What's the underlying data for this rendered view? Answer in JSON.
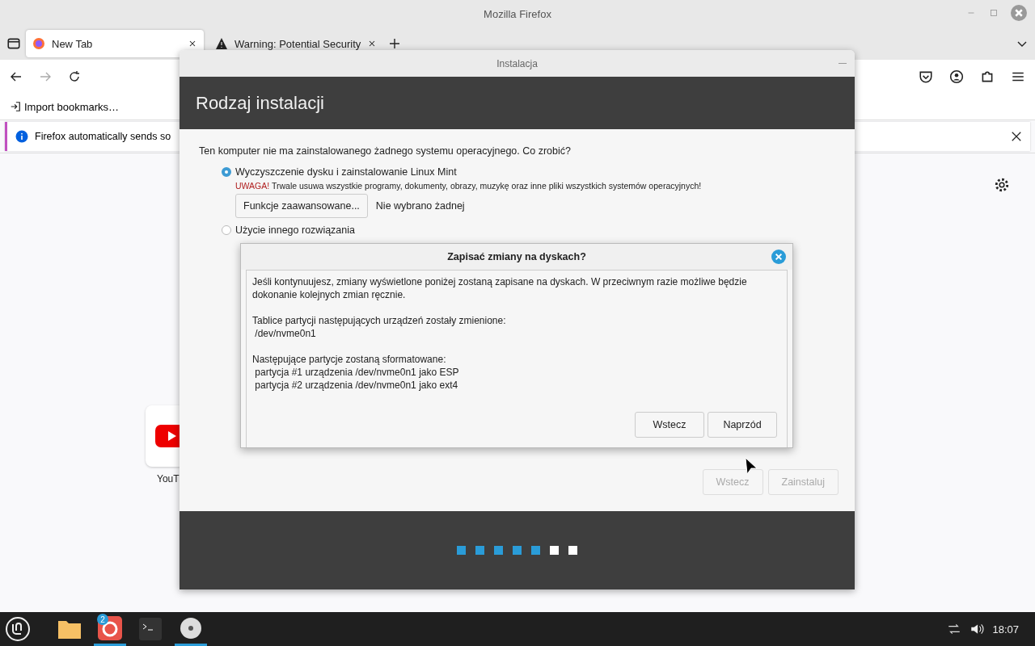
{
  "browser": {
    "title": "Mozilla Firefox",
    "tabs": [
      {
        "label": "New Tab",
        "selected": true
      },
      {
        "label": "Warning: Potential Security",
        "selected": false
      }
    ],
    "bookmarks": [
      "Import bookmarks…"
    ],
    "notification": "Firefox automatically sends so",
    "shortcuts": [
      {
        "label": "YouT"
      }
    ]
  },
  "installer": {
    "title": "Instalacja",
    "heading": "Rodzaj instalacji",
    "question": "Ten komputer nie ma zainstalowanego żadnego systemu operacyjnego. Co zrobić?",
    "options": [
      {
        "label": "Wyczyszczenie dysku i zainstalowanie Linux Mint",
        "selected": true,
        "warning_tag": "UWAGA!",
        "warning": "Trwale usuwa wszystkie programy, dokumenty, obrazy, muzykę oraz inne pliki wszystkich systemów operacyjnych!",
        "button": "Funkcje zaawansowane...",
        "note": "Nie wybrano żadnej"
      },
      {
        "label": "Użycie innego rozwiązania",
        "selected": false
      }
    ],
    "buttons": [
      {
        "label": "Wstecz",
        "disabled": true
      },
      {
        "label": "Zainstaluj",
        "disabled": true
      }
    ],
    "steps": [
      {
        "done": true
      },
      {
        "done": true
      },
      {
        "done": true
      },
      {
        "done": true
      },
      {
        "done": true
      },
      {
        "done": false
      },
      {
        "done": false
      }
    ]
  },
  "dialog": {
    "title": "Zapisać zmiany na dyskach?",
    "paragraphs": [
      [
        "Jeśli kontynuujesz, zmiany wyświetlone poniżej zostaną zapisane na dyskach. W przeciwnym razie możliwe będzie dokonanie kolejnych zmian ręcznie."
      ],
      [
        "Tablice partycji następujących urządzeń zostały zmienione:",
        " /dev/nvme0n1"
      ],
      [
        "Następujące partycje zostaną sformatowane:",
        " partycja #1 urządzenia /dev/nvme0n1 jako ESP",
        " partycja #2 urządzenia /dev/nvme0n1 jako ext4"
      ]
    ],
    "buttons": [
      "Wstecz",
      "Naprzód"
    ]
  },
  "taskbar": {
    "apps": [
      {
        "kind": "files",
        "active": false
      },
      {
        "kind": "firefox",
        "active": true,
        "badge": "2"
      },
      {
        "kind": "terminal",
        "active": false
      },
      {
        "kind": "disc",
        "active": true
      }
    ],
    "clock": "18:07"
  }
}
